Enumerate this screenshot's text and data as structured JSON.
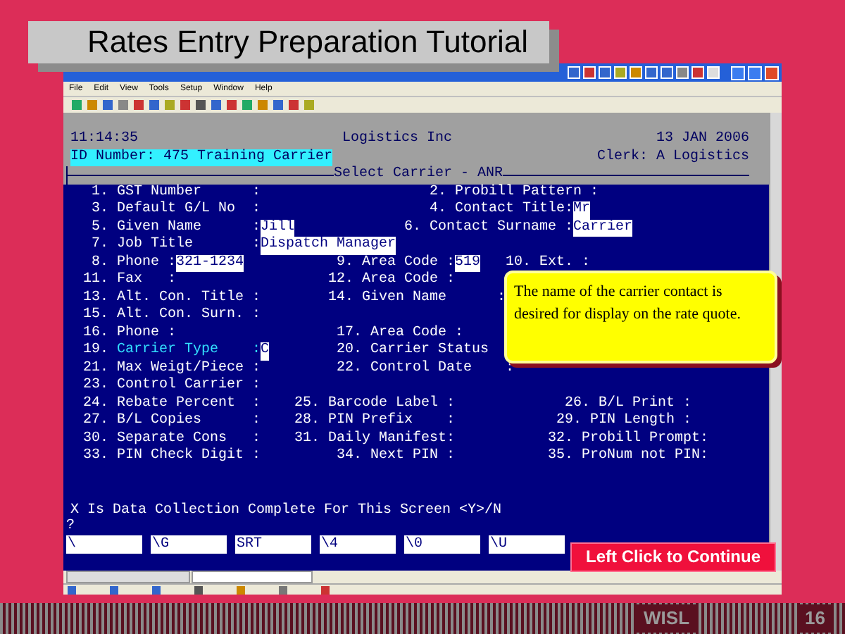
{
  "slide": {
    "title": "Rates Entry Preparation Tutorial",
    "footer": "WISL",
    "page_number": "16"
  },
  "window": {
    "menu": [
      "File",
      "Edit",
      "View",
      "Tools",
      "Setup",
      "Window",
      "Help"
    ]
  },
  "terminal": {
    "time": "11:14:35",
    "company": "Logistics Inc",
    "date": "13 JAN 2006",
    "id_line": "ID Number: 475 Training Carrier",
    "clerk": "Clerk: A Logistics",
    "screen_title": "Select Carrier - ANR",
    "rows": [
      [
        {
          "number": "1.",
          "label": "GST Number      :",
          "current": false
        },
        {
          "number": "2.",
          "label": "Probill Pattern :",
          "current": false
        }
      ],
      [
        {
          "number": "3.",
          "label": "Default G/L No  :",
          "current": false
        },
        {
          "number": "4.",
          "label": "Contact Title:",
          "value": "Mr",
          "current": false
        }
      ],
      [
        {
          "number": "5.",
          "label": "Given Name      :",
          "value": "Jill",
          "current": false
        },
        {
          "number": "6.",
          "label": "Contact Surname :",
          "value": "Carrier",
          "current": false
        }
      ],
      [
        {
          "number": "7.",
          "label": "Job Title       :",
          "value": "Dispatch Manager",
          "current": false
        }
      ],
      [
        {
          "number": "8.",
          "label": "Phone :",
          "value": "321-1234",
          "current": false
        },
        {
          "number": "9.",
          "label": "Area Code :",
          "value": "519",
          "current": false
        },
        {
          "number": "10.",
          "label": "Ext. :",
          "current": false
        }
      ],
      [
        {
          "number": "11.",
          "label": "Fax   :",
          "current": false
        },
        {
          "number": "12.",
          "label": "Area Code :",
          "current": false
        }
      ],
      [
        {
          "number": "13.",
          "label": "Alt. Con. Title :",
          "current": false
        },
        {
          "number": "14.",
          "label": "Given Name      :",
          "current": false
        }
      ],
      [
        {
          "number": "15.",
          "label": "Alt. Con. Surn. :",
          "current": false
        }
      ],
      [
        {
          "number": "16.",
          "label": "Phone :",
          "current": false
        },
        {
          "number": "17.",
          "label": "Area Code :",
          "current": false
        }
      ],
      [
        {
          "number": "19.",
          "label": "Carrier Type    :",
          "value": "C",
          "current": true
        },
        {
          "number": "20.",
          "label": "Carrier Status",
          "current": false
        }
      ],
      [
        {
          "number": "21.",
          "label": "Max Weigt/Piece :",
          "current": false
        },
        {
          "number": "22.",
          "label": "Control Date    :",
          "current": false
        }
      ],
      [
        {
          "number": "23.",
          "label": "Control Carrier :",
          "current": false
        }
      ],
      [
        {
          "number": "24.",
          "label": "Rebate Percent  :",
          "current": false
        },
        {
          "number": "25.",
          "label": "Barcode Label :",
          "current": false
        },
        {
          "number": "26.",
          "label": "B/L Print :",
          "current": false
        }
      ],
      [
        {
          "number": "27.",
          "label": "B/L Copies      :",
          "current": false
        },
        {
          "number": "28.",
          "label": "PIN Prefix    :",
          "current": false
        },
        {
          "number": "29.",
          "label": "PIN Length :",
          "current": false
        }
      ],
      [
        {
          "number": "30.",
          "label": "Separate Cons   :",
          "current": false
        },
        {
          "number": "31.",
          "label": "Daily Manifest:",
          "current": false
        },
        {
          "number": "32.",
          "label": "Probill Prompt:",
          "current": false
        }
      ],
      [
        {
          "number": "33.",
          "label": "PIN Check Digit :",
          "current": false
        },
        {
          "number": "34.",
          "label": "Next PIN :",
          "current": false
        },
        {
          "number": "35.",
          "label": "ProNum not PIN:",
          "current": false
        }
      ]
    ],
    "prompt": "X Is Data Collection Complete For This Screen <Y>/N",
    "prompt_input": "?",
    "function_keys": [
      "\\",
      "\\G",
      "SRT",
      "\\4",
      "\\0",
      "\\U"
    ]
  },
  "callout": "The name of the carrier contact is desired for display on the rate quote.",
  "continue_button": "Left Click to Continue"
}
